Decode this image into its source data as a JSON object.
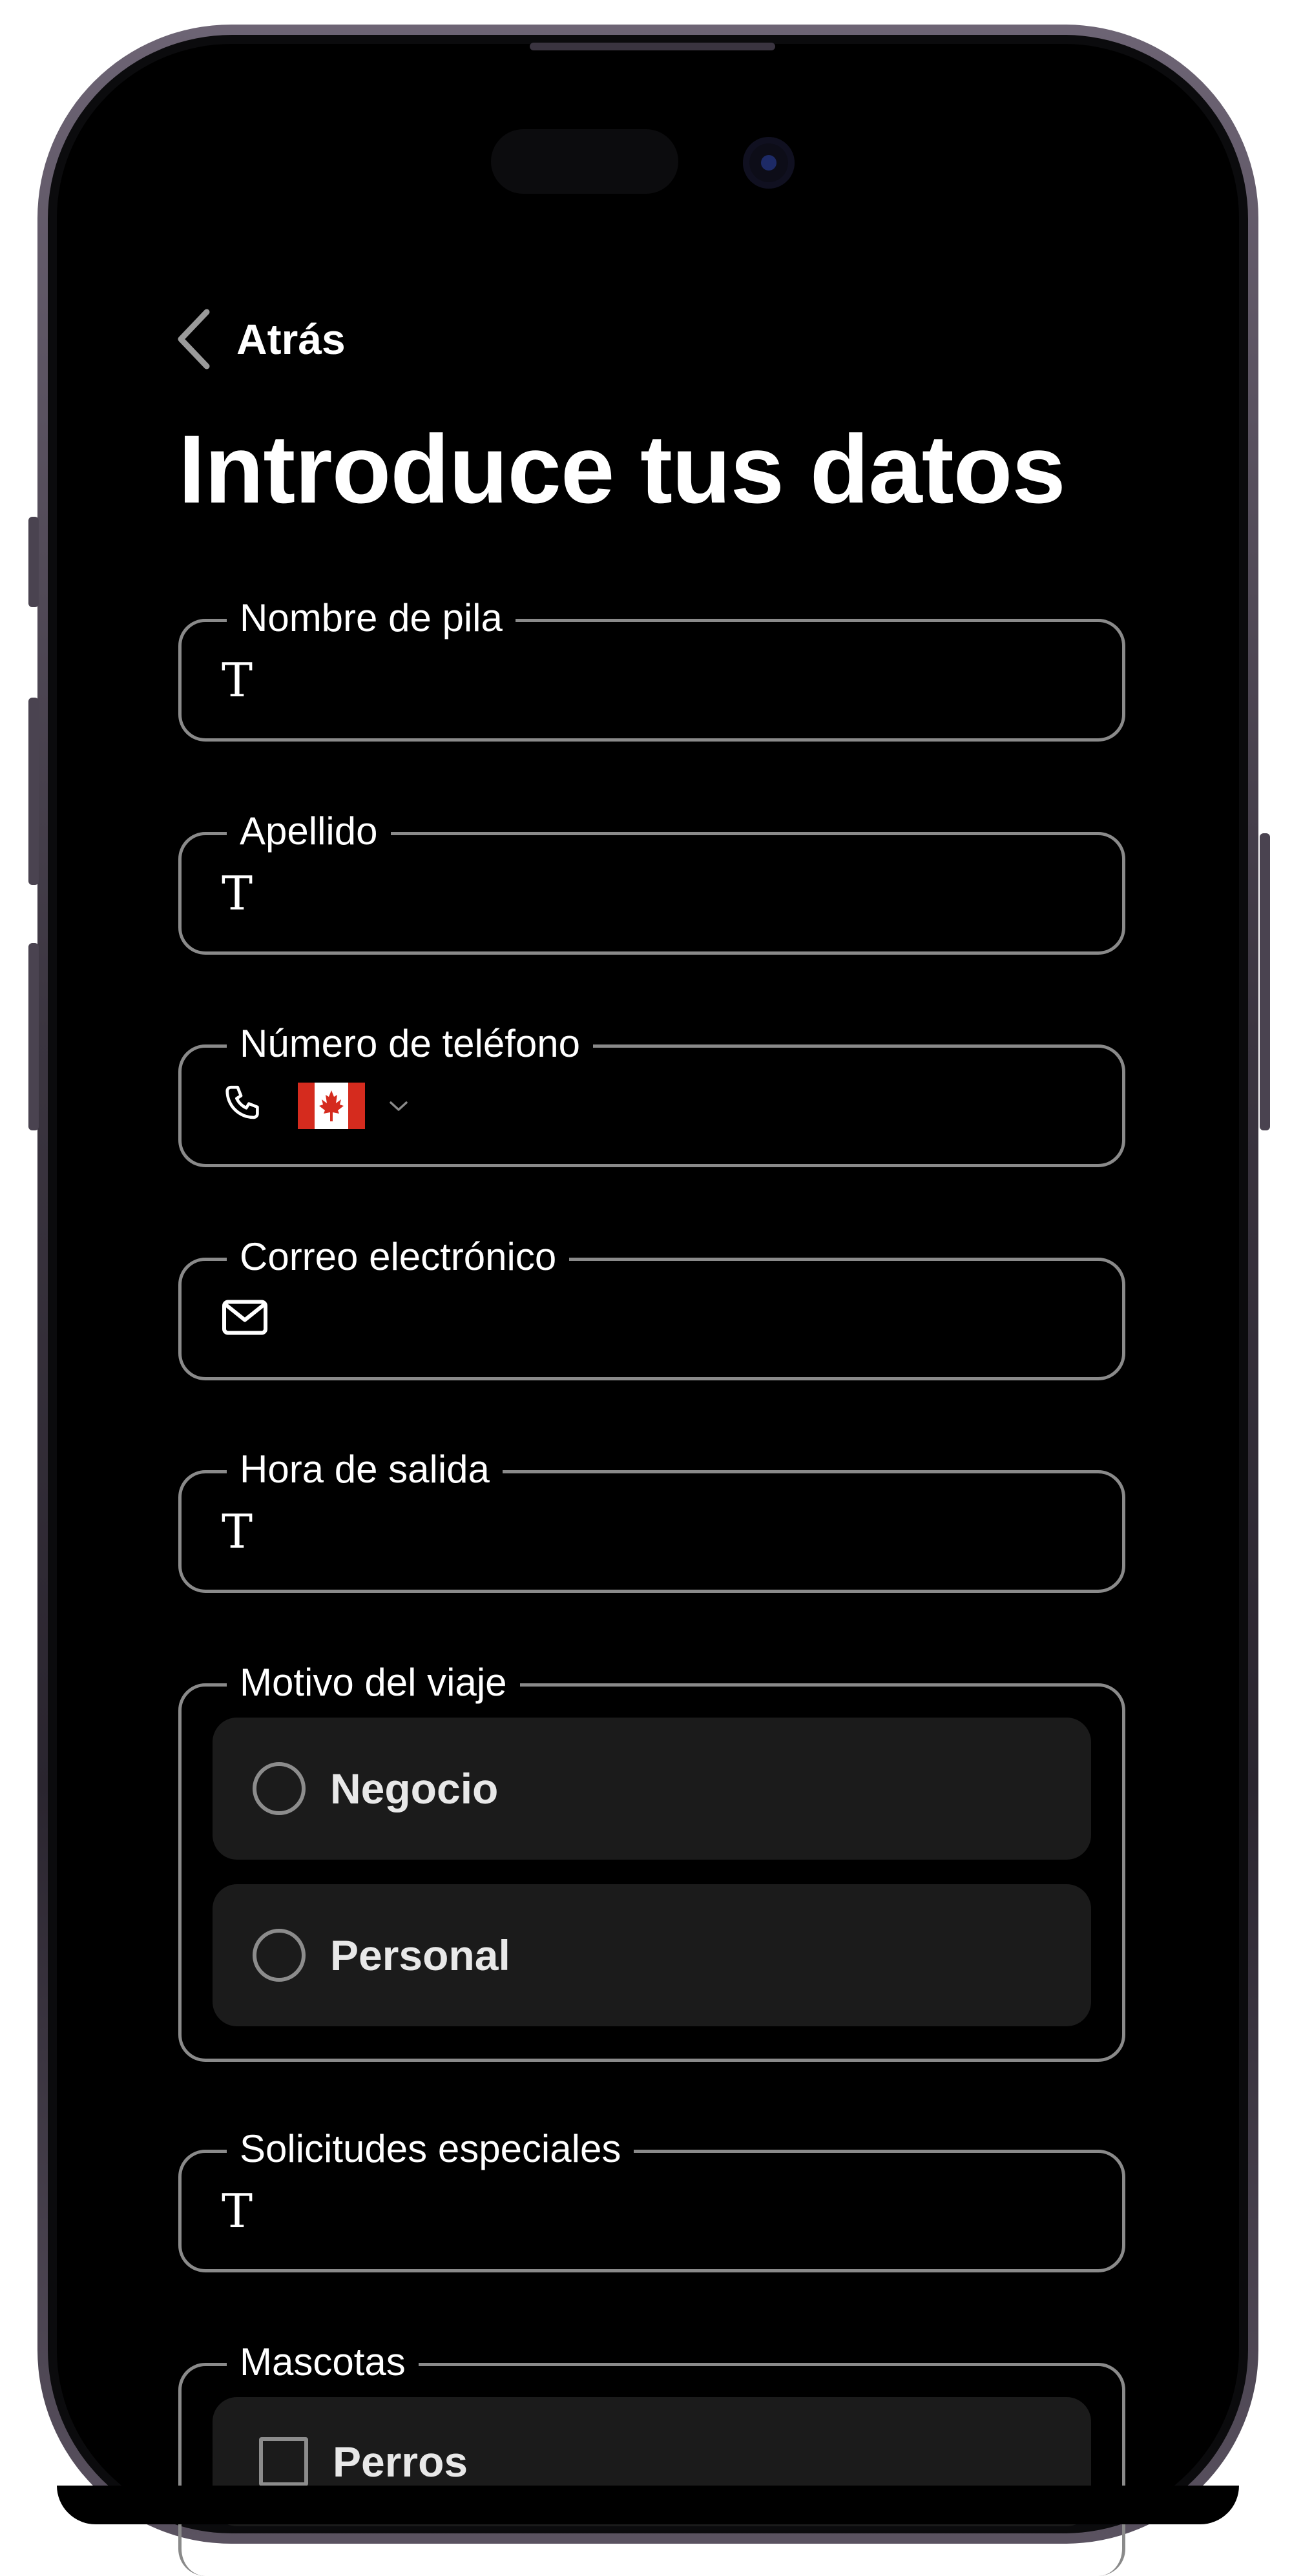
{
  "nav": {
    "back_label": "Atrás"
  },
  "page": {
    "title": "Introduce tus datos"
  },
  "fields": {
    "first_name": {
      "label": "Nombre de pila",
      "icon": "text-type-icon"
    },
    "last_name": {
      "label": "Apellido",
      "icon": "text-type-icon"
    },
    "phone": {
      "label": "Número de teléfono",
      "icon": "phone-icon",
      "country_flag": "canada-flag-icon"
    },
    "email": {
      "label": "Correo electrónico",
      "icon": "mail-icon"
    },
    "departure_time": {
      "label": "Hora de salida",
      "icon": "text-type-icon"
    },
    "special_requests": {
      "label": "Solicitudes especiales",
      "icon": "text-type-icon"
    }
  },
  "trip_reason": {
    "label": "Motivo del viaje",
    "options": [
      {
        "label": "Negocio",
        "selected": false
      },
      {
        "label": "Personal",
        "selected": false
      }
    ]
  },
  "pets": {
    "label": "Mascotas",
    "options": [
      {
        "label": "Perros",
        "checked": false
      }
    ]
  },
  "colors": {
    "background": "#000000",
    "border": "#8a8a8a",
    "option_bg": "#1b1b1b",
    "text": "#ffffff",
    "flag_red": "#d52b1e"
  }
}
